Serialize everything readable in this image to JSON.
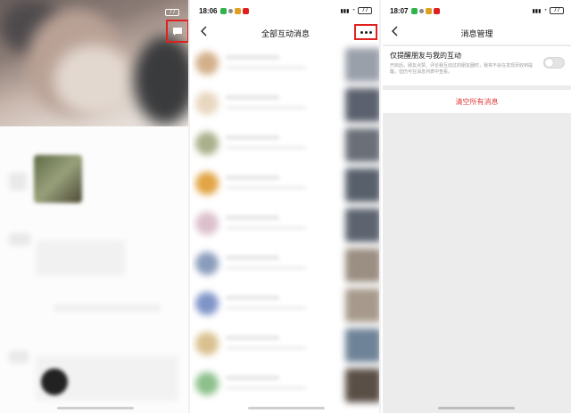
{
  "screens": [
    {
      "id": "profile-screen",
      "status": {
        "battery": "77"
      },
      "icons": {
        "chat": "chat-bubble-icon"
      },
      "colors": {
        "highlight": "#e0201e"
      }
    },
    {
      "id": "all-interactions-screen",
      "status": {
        "time": "18:06",
        "battery": "77"
      },
      "nav": {
        "back_icon": "chevron-left-icon",
        "title": "全部互动消息",
        "more_icon": "more-dots-icon"
      },
      "list_rows": 9
    },
    {
      "id": "message-management-screen",
      "status": {
        "time": "18:07",
        "battery": "77"
      },
      "nav": {
        "back_icon": "chevron-left-icon",
        "title": "消息管理"
      },
      "setting": {
        "label": "仅提醒朋友与我的互动",
        "description": "开启后，朋友点赞、评论我互动过的朋友圈时，我将不会在发现页收到提醒，但仍可在消息列表中查看。",
        "toggle_on": false
      },
      "clear_action": {
        "label": "清空所有消息",
        "color": "#e03c3c"
      }
    }
  ]
}
